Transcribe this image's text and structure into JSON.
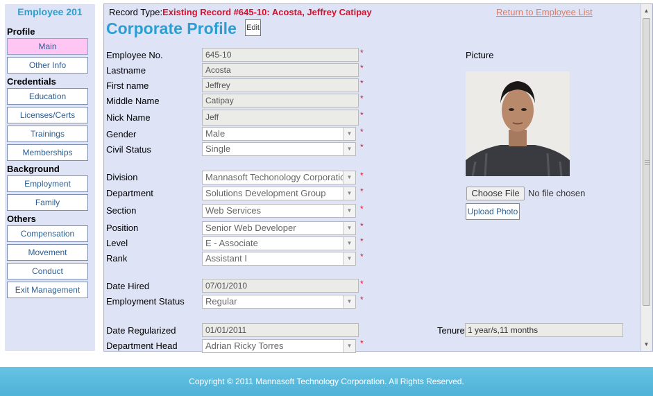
{
  "sidebar": {
    "title": "Employee 201",
    "sections": {
      "profile": "Profile",
      "credentials": "Credentials",
      "background": "Background",
      "others": "Others"
    },
    "buttons": {
      "main": "Main",
      "other_info": "Other Info",
      "education": "Education",
      "licenses": "Licenses/Certs",
      "trainings": "Trainings",
      "memberships": "Memberships",
      "employment": "Employment",
      "family": "Family",
      "compensation": "Compensation",
      "movement": "Movement",
      "conduct": "Conduct",
      "exit_management": "Exit Management"
    }
  },
  "header": {
    "record_type_label": "Record Type:",
    "record_type_value": "Existing Record #645-10: Acosta, Jeffrey Catipay",
    "return_link": "Return to Employee List",
    "title": "Corporate Profile",
    "edit_label": "Edit"
  },
  "required_mark": "*",
  "form": {
    "employee_no": {
      "label": "Employee No.",
      "value": "645-10"
    },
    "lastname": {
      "label": "Lastname",
      "value": "Acosta"
    },
    "firstname": {
      "label": "First name",
      "value": "Jeffrey"
    },
    "middlename": {
      "label": "Middle Name",
      "value": "Catipay"
    },
    "nickname": {
      "label": "Nick Name",
      "value": "Jeff"
    },
    "gender": {
      "label": "Gender",
      "value": "Male"
    },
    "civil_status": {
      "label": "Civil Status",
      "value": "Single"
    },
    "division": {
      "label": "Division",
      "value": "Mannasoft Techonology Corporation"
    },
    "department": {
      "label": "Department",
      "value": "Solutions Development Group"
    },
    "section": {
      "label": "Section",
      "value": "Web Services"
    },
    "position": {
      "label": "Position",
      "value": "Senior Web Developer"
    },
    "level": {
      "label": "Level",
      "value": "E - Associate"
    },
    "rank": {
      "label": "Rank",
      "value": "Assistant I"
    },
    "date_hired": {
      "label": "Date Hired",
      "value": "07/01/2010"
    },
    "employment_status": {
      "label": "Employment Status",
      "value": "Regular"
    },
    "date_regularized": {
      "label": "Date Regularized",
      "value": "01/01/2011"
    },
    "department_head": {
      "label": "Department Head",
      "value": "Adrian Ricky Torres"
    }
  },
  "picture": {
    "label": "Picture",
    "choose_file": "Choose File",
    "no_file": "No file chosen",
    "upload": "Upload Photo"
  },
  "tenure": {
    "label": "Tenure",
    "value": "1 year/s,11 months"
  },
  "footer": {
    "copyright": "Copyright © 2011 Mannasoft Technology Corporation. All Rights Reserved."
  },
  "colors": {
    "accent": "#2b9fd1",
    "panel_bg": "#dfe3f6",
    "active_tab": "#ffc5f3",
    "record_red": "#d7102c",
    "footer_bg": "#58b8dc"
  }
}
